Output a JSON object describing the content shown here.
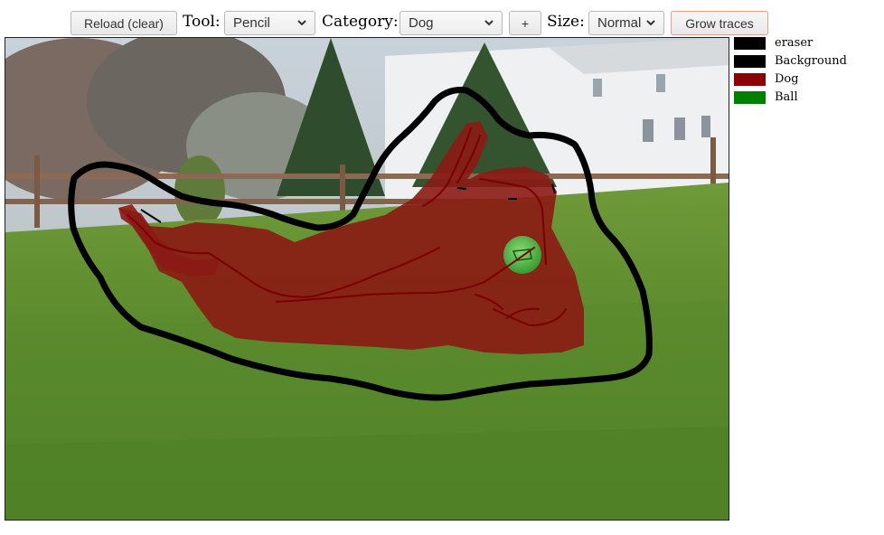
{
  "toolbar": {
    "reload_label": "Reload (clear)",
    "tool_label": "Tool:",
    "tool_value": "Pencil",
    "category_label": "Category:",
    "category_value": "Dog",
    "add_label": "+",
    "size_label": "Size:",
    "size_value": "Normal",
    "grow_label": "Grow traces"
  },
  "legend": [
    {
      "label": "eraser",
      "color": "#000000"
    },
    {
      "label": "Background",
      "color": "#000000"
    },
    {
      "label": "Dog",
      "color": "#8b0000"
    },
    {
      "label": "Ball",
      "color": "#008000"
    }
  ],
  "colors": {
    "dog_overlay": "#8b1a14",
    "ball_overlay": "#3fbf3f",
    "background_trace": "#000000",
    "dog_trace": "#8b0000"
  }
}
